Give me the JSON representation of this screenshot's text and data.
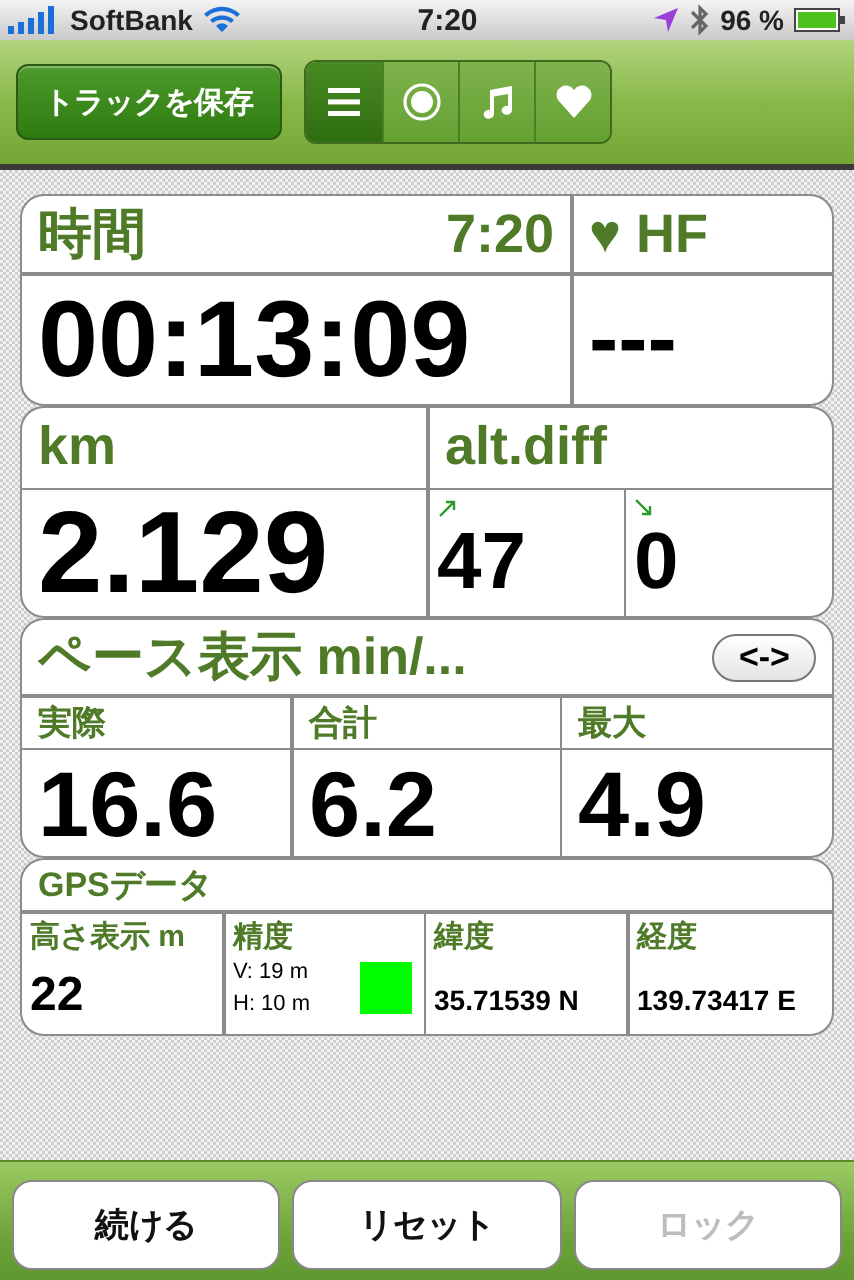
{
  "status_bar": {
    "carrier": "SoftBank",
    "time": "7:20",
    "battery": "96 %"
  },
  "toolbar": {
    "save_button": "トラックを保存",
    "segments": [
      {
        "kind": "list",
        "selected": true
      },
      {
        "kind": "record",
        "selected": false
      },
      {
        "kind": "music",
        "selected": false
      },
      {
        "kind": "heart",
        "selected": false
      }
    ]
  },
  "time_card": {
    "title": "時間",
    "clock": "7:20",
    "value": "00:13:09",
    "hf_title": "♥ HF",
    "hf_value": "---"
  },
  "distance_card": {
    "title": "km",
    "value": "2.129",
    "alt_title": "alt.diff",
    "ascent": "47",
    "descent": "0"
  },
  "pace_card": {
    "title": "ペース表示 min/...",
    "toggle": "<->",
    "columns": [
      {
        "label": "実際",
        "value": "16.6"
      },
      {
        "label": "合計",
        "value": "6.2"
      },
      {
        "label": "最大",
        "value": "4.9"
      }
    ]
  },
  "gps_card": {
    "title": "GPSデータ",
    "altitude": {
      "label": "高さ表示 m",
      "value": "22"
    },
    "accuracy": {
      "label": "精度",
      "vertical": "V: 19 m",
      "horizontal": "H: 10 m",
      "color": "#00ff00"
    },
    "latitude": {
      "label": "緯度",
      "value": "35.71539 N"
    },
    "longitude": {
      "label": "経度",
      "value": "139.73417 E"
    }
  },
  "buttons": [
    {
      "label": "続ける",
      "disabled": false
    },
    {
      "label": "リセット",
      "disabled": false
    },
    {
      "label": "ロック",
      "disabled": true
    }
  ]
}
